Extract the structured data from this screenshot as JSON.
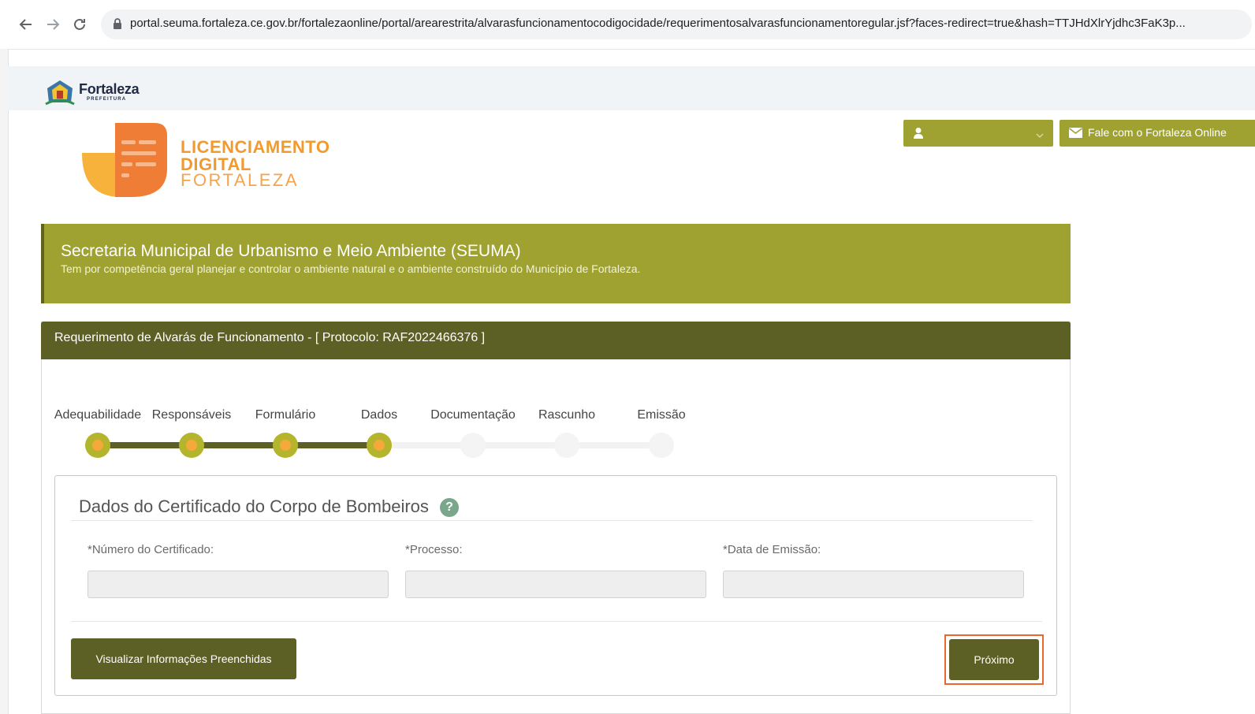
{
  "browser": {
    "url": "portal.seuma.fortaleza.ce.gov.br/fortalezaonline/portal/arearestrita/alvarasfuncionamentocodigocidade/requerimentosalvarasfuncionamentoregular.jsf?faces-redirect=true&hash=TTJHdXlrYjdhc3FaK3p..."
  },
  "header": {
    "city_logo_name": "Fortaleza",
    "city_logo_sub": "PREFEITURA",
    "brand_line1": "LICENCIAMENTO",
    "brand_line2": "DIGITAL",
    "brand_line3": "FORTALEZA",
    "contact_button": "Fale com o Fortaleza Online"
  },
  "banner": {
    "title": "Secretaria Municipal de Urbanismo e Meio Ambiente (SEUMA)",
    "description": "Tem por competência geral planejar e controlar o ambiente natural e o ambiente construído do Município de Fortaleza."
  },
  "panel": {
    "title": "Requerimento de Alvarás de Funcionamento - [ Protocolo: RAF2022466376 ]"
  },
  "steps": [
    {
      "label": "Adequabilidade",
      "done": true
    },
    {
      "label": "Responsáveis",
      "done": true
    },
    {
      "label": "Formulário",
      "done": true
    },
    {
      "label": "Dados",
      "done": true
    },
    {
      "label": "Documentação",
      "done": false
    },
    {
      "label": "Rascunho",
      "done": false
    },
    {
      "label": "Emissão",
      "done": false
    }
  ],
  "form": {
    "title": "Dados do Certificado do Corpo de Bombeiros",
    "help": "?",
    "fields": [
      {
        "label": "*Número do Certificado:",
        "value": ""
      },
      {
        "label": "*Processo:",
        "value": ""
      },
      {
        "label": "*Data de Emissão:",
        "value": ""
      }
    ],
    "view_button": "Visualizar Informações Preenchidas",
    "next_button": "Próximo"
  },
  "colors": {
    "olive": "#9fa231",
    "olive_dark": "#5d6024",
    "orange": "#f29a2e",
    "highlight": "#e8672f"
  }
}
